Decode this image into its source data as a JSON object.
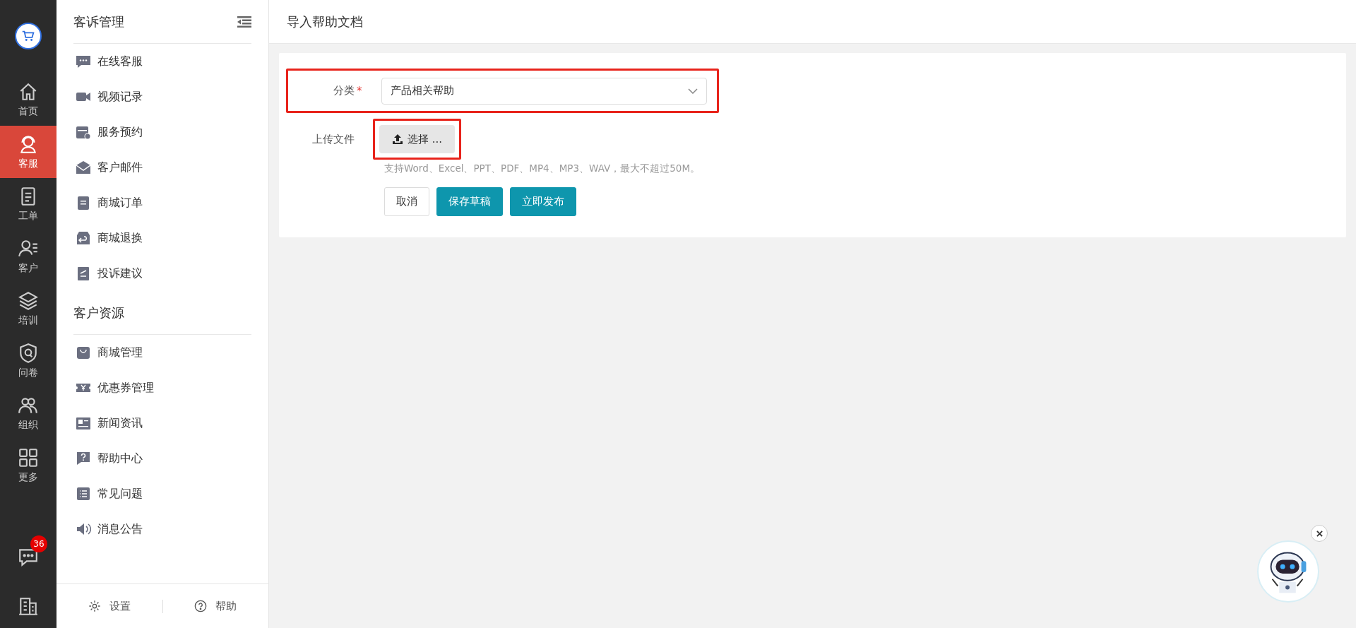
{
  "rail": {
    "items": [
      {
        "label": "首页",
        "selected": false
      },
      {
        "label": "客服",
        "selected": true
      },
      {
        "label": "工单",
        "selected": false
      },
      {
        "label": "客户",
        "selected": false
      },
      {
        "label": "培训",
        "selected": false
      },
      {
        "label": "问卷",
        "selected": false
      },
      {
        "label": "组织",
        "selected": false
      },
      {
        "label": "更多",
        "selected": false
      }
    ],
    "chat_badge": "36"
  },
  "sidebar": {
    "sections": [
      {
        "title": "客诉管理",
        "items": [
          "在线客服",
          "视频记录",
          "服务预约",
          "客户邮件",
          "商城订单",
          "商城退换",
          "投诉建议"
        ]
      },
      {
        "title": "客户资源",
        "items": [
          "商城管理",
          "优惠券管理",
          "新闻资讯",
          "帮助中心",
          "常见问题",
          "消息公告"
        ]
      }
    ],
    "footer": [
      "设置",
      "帮助"
    ]
  },
  "page": {
    "title": "导入帮助文档"
  },
  "form": {
    "category": {
      "label": "分类",
      "required_mark": "*",
      "value": "产品相关帮助",
      "highlighted": true
    },
    "upload": {
      "label": "上传文件",
      "button": "选择 ...",
      "hint": "支持Word、Excel、PPT、PDF、MP4、MP3、WAV，最大不超过50M。",
      "highlighted": true
    },
    "buttons": [
      {
        "label": "取消",
        "kind": "plain"
      },
      {
        "label": "保存草稿",
        "kind": "primary"
      },
      {
        "label": "立即发布",
        "kind": "primary"
      }
    ]
  }
}
